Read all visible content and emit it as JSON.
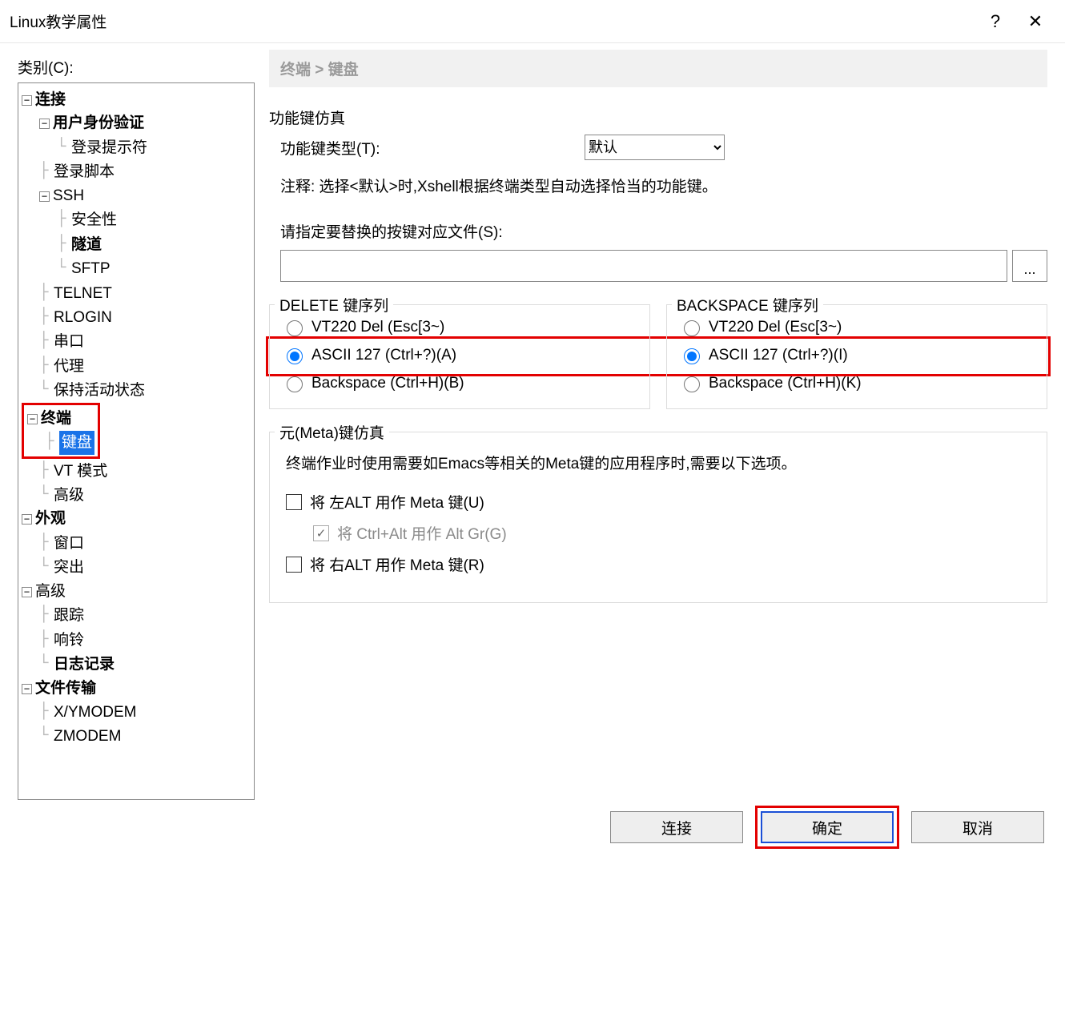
{
  "title": "Linux教学属性",
  "titlebar": {
    "help": "?",
    "close": "✕"
  },
  "category_label": "类别(C):",
  "tree": {
    "connection": "连接",
    "auth": "用户身份验证",
    "login_prompt": "登录提示符",
    "login_script": "登录脚本",
    "ssh": "SSH",
    "security": "安全性",
    "tunnel": "隧道",
    "sftp": "SFTP",
    "telnet": "TELNET",
    "rlogin": "RLOGIN",
    "serial": "串口",
    "proxy": "代理",
    "keepalive": "保持活动状态",
    "terminal": "终端",
    "keyboard": "键盘",
    "vtmode": "VT 模式",
    "advanced_t": "高级",
    "appearance": "外观",
    "window": "窗口",
    "highlight": "突出",
    "advanced": "高级",
    "trace": "跟踪",
    "bell": "响铃",
    "logging": "日志记录",
    "filetransfer": "文件传输",
    "xymodem": "X/YMODEM",
    "zmodem": "ZMODEM"
  },
  "breadcrumb": "终端 > 键盘",
  "funckey": {
    "section": "功能键仿真",
    "type_label": "功能键类型(T):",
    "type_value": "默认",
    "note": "注释: 选择<默认>时,Xshell根据终端类型自动选择恰当的功能键。",
    "map_label": "请指定要替换的按键对应文件(S):",
    "map_value": "",
    "browse": "..."
  },
  "delete": {
    "title": "DELETE 键序列",
    "opt1": "VT220 Del (Esc[3~)",
    "opt2": "ASCII 127 (Ctrl+?)(A)",
    "opt3": "Backspace (Ctrl+H)(B)",
    "selected": 2
  },
  "backspace": {
    "title": "BACKSPACE 键序列",
    "opt1": "VT220 Del (Esc[3~)",
    "opt2": "ASCII 127 (Ctrl+?)(I)",
    "opt3": "Backspace (Ctrl+H)(K)",
    "selected": 2
  },
  "meta": {
    "title": "元(Meta)键仿真",
    "desc": "终端作业时使用需要如Emacs等相关的Meta键的应用程序时,需要以下选项。",
    "left_alt": "将 左ALT 用作 Meta 键(U)",
    "ctrl_alt": "将 Ctrl+Alt 用作 Alt Gr(G)",
    "right_alt": "将 右ALT 用作 Meta 键(R)",
    "left_alt_checked": false,
    "ctrl_alt_checked": true,
    "right_alt_checked": false
  },
  "footer": {
    "connect": "连接",
    "ok": "确定",
    "cancel": "取消"
  }
}
